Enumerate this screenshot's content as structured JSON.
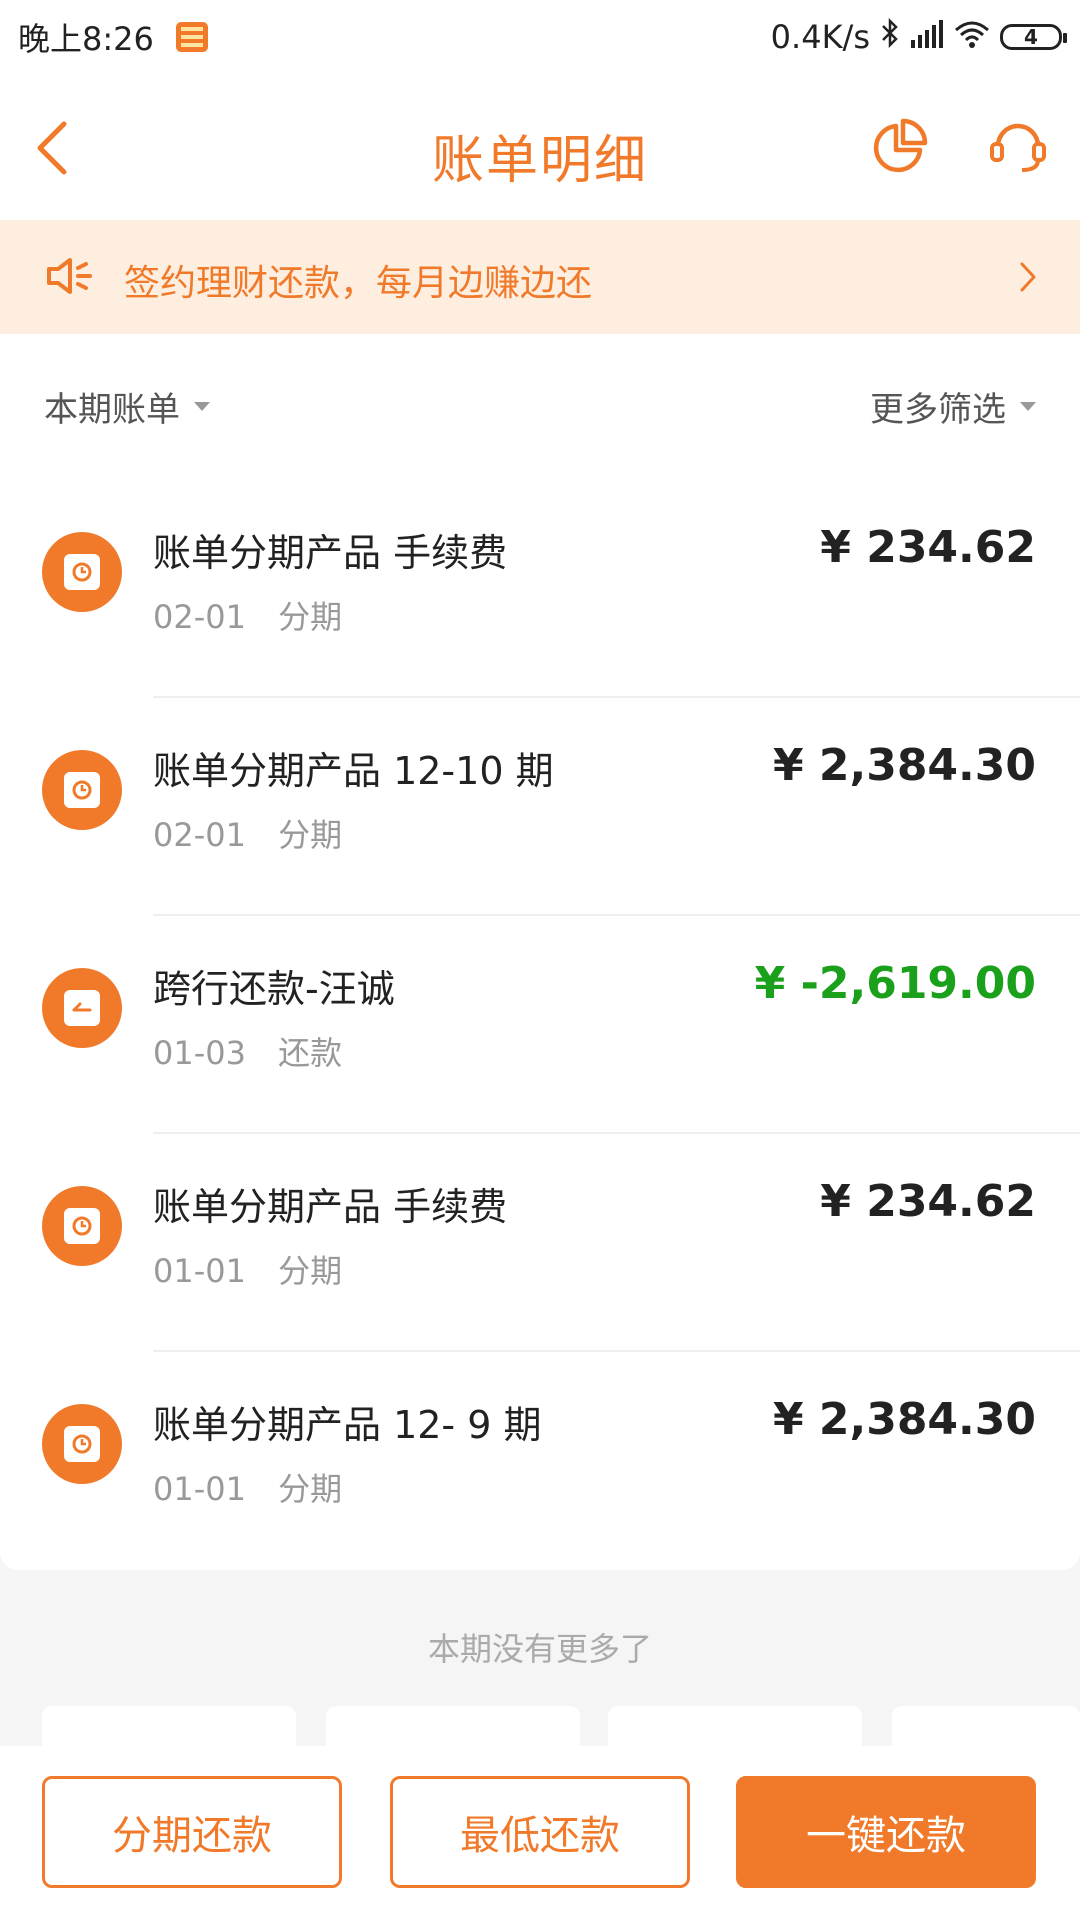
{
  "status_bar": {
    "time": "晚上8:26",
    "speed": "0.4K/s",
    "battery": "4"
  },
  "header": {
    "title": "账单明细"
  },
  "banner": {
    "text": "签约理财还款，每月边赚边还"
  },
  "filters": {
    "period": "本期账单",
    "more": "更多筛选"
  },
  "transactions": [
    {
      "name": "账单分期产品 手续费",
      "date": "02-01",
      "type": "分期",
      "amount": "¥ 234.62"
    },
    {
      "name": "账单分期产品 12-10 期",
      "date": "02-01",
      "type": "分期",
      "amount": "¥ 2,384.30"
    },
    {
      "name": "跨行还款-汪诚",
      "date": "01-03",
      "type": "还款",
      "amount": "¥ -2,619.00"
    },
    {
      "name": "账单分期产品 手续费",
      "date": "01-01",
      "type": "分期",
      "amount": "¥ 234.62"
    },
    {
      "name": "账单分期产品 12- 9 期",
      "date": "01-01",
      "type": "分期",
      "amount": "¥ 2,384.30"
    }
  ],
  "footer_note": "本期没有更多了",
  "actions": {
    "installment": "分期还款",
    "minimum": "最低还款",
    "one_click": "一键还款"
  },
  "colors": {
    "accent": "#f07a2a",
    "negative_amount": "#1aa01a",
    "banner_bg": "#fdeee0"
  }
}
